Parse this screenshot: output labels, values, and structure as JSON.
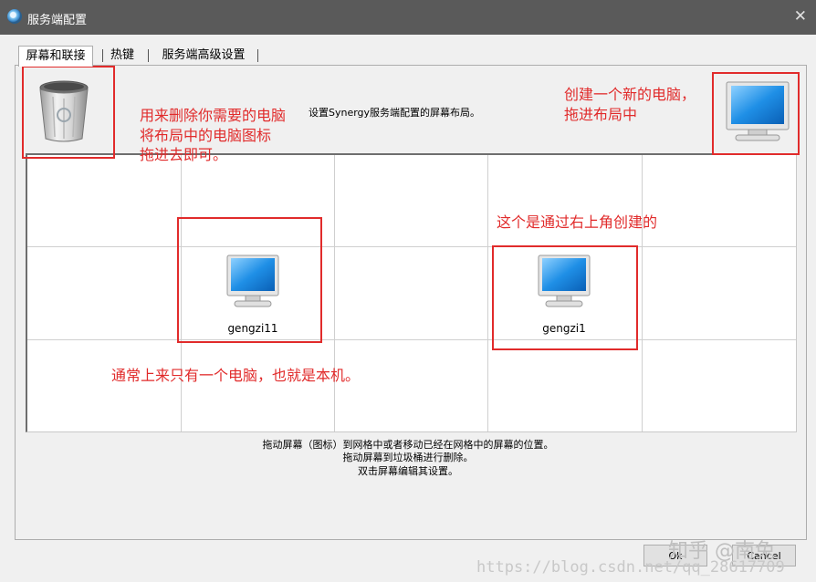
{
  "window": {
    "title": "服务端配置",
    "close_glyph": "✕"
  },
  "tabs": [
    {
      "label": "屏幕和联接",
      "active": true
    },
    {
      "label": "热键",
      "active": false
    },
    {
      "label": "服务端高级设置",
      "active": false
    }
  ],
  "hint": "设置Synergy服务端配置的屏幕布局。",
  "annotations": {
    "trash_line1": "用来删除你需要的电脑",
    "trash_line2": "将布局中的电脑图标",
    "trash_line3": "拖进去即可。",
    "new_line1": "创建一个新的电脑，",
    "new_line2": "拖进布局中",
    "created": "这个是通过右上角创建的",
    "local": "通常上来只有一个电脑，也就是本机。"
  },
  "screens": [
    {
      "name": "gengzi11"
    },
    {
      "name": "gengzi1"
    }
  ],
  "instructions": {
    "line1": "拖动屏幕（图标）到网格中或者移动已经在网格中的屏幕的位置。",
    "line2": "拖动屏幕到垃圾桶进行删除。",
    "line3": "双击屏幕编辑其设置。"
  },
  "buttons": {
    "ok": "Ok",
    "cancel": "Cancel"
  },
  "watermarks": {
    "csdn": "https://blog.csdn.net/qq_28617709",
    "zhihu": "知乎 @南兔"
  },
  "colors": {
    "annotation_red": "#e12b2b",
    "titlebar": "#5a5a5a"
  },
  "icons": {
    "trash": "trash-bin-icon",
    "monitor": "monitor-icon",
    "app": "synergy-app-icon"
  }
}
